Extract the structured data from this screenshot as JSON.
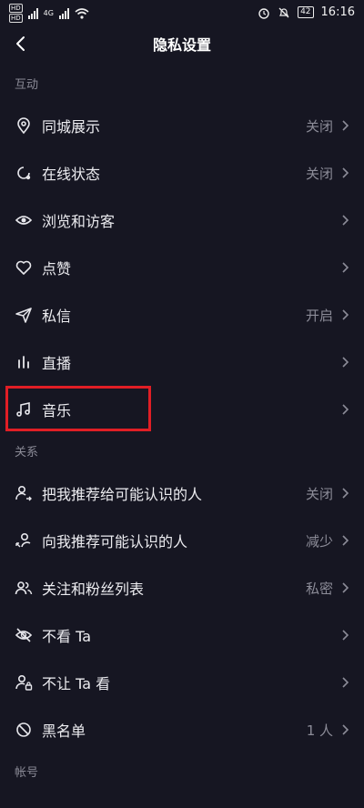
{
  "status_bar": {
    "time": "16:16",
    "battery": "42",
    "hd1": "HD",
    "hd2": "HD",
    "net": "4G"
  },
  "header": {
    "title": "隐私设置",
    "back_icon": "chevron-left-icon"
  },
  "sections": [
    {
      "title": "互动",
      "items": [
        {
          "label": "同城展示",
          "value": "关闭",
          "icon": "location-pin-icon"
        },
        {
          "label": "在线状态",
          "value": "关闭",
          "icon": "online-status-icon"
        },
        {
          "label": "浏览和访客",
          "value": "",
          "icon": "eye-icon"
        },
        {
          "label": "点赞",
          "value": "",
          "icon": "heart-icon"
        },
        {
          "label": "私信",
          "value": "开启",
          "icon": "paper-plane-icon"
        },
        {
          "label": "直播",
          "value": "",
          "icon": "live-bars-icon"
        },
        {
          "label": "音乐",
          "value": "",
          "icon": "music-note-icon"
        }
      ]
    },
    {
      "title": "关系",
      "items": [
        {
          "label": "把我推荐给可能认识的人",
          "value": "关闭",
          "icon": "user-share-icon"
        },
        {
          "label": "向我推荐可能认识的人",
          "value": "减少",
          "icon": "user-recommend-icon"
        },
        {
          "label": "关注和粉丝列表",
          "value": "私密",
          "icon": "users-icon"
        },
        {
          "label": "不看 Ta",
          "value": "",
          "icon": "eye-off-icon"
        },
        {
          "label": "不让 Ta 看",
          "value": "",
          "icon": "user-lock-icon"
        },
        {
          "label": "黑名单",
          "value": "1 人",
          "icon": "block-icon"
        }
      ]
    },
    {
      "title": "帐号",
      "items": []
    }
  ],
  "colors": {
    "background": "#161622",
    "highlight": "#e01e25"
  }
}
